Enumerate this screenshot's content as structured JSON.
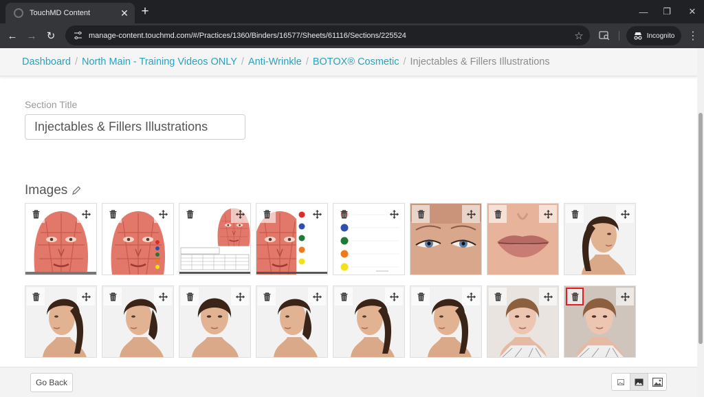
{
  "browser": {
    "tab_title": "TouchMD Content",
    "tab_close": "✕",
    "new_tab": "+",
    "url": "manage-content.touchmd.com/#/Practices/1360/Binders/16577/Sheets/61116/Sections/225524",
    "incognito_label": "Incognito",
    "controls": {
      "minimize": "—",
      "restore": "❐",
      "close": "✕",
      "back": "←",
      "forward": "→",
      "reload": "↻",
      "star": "☆",
      "menu": "⋮"
    }
  },
  "breadcrumb": {
    "items": [
      "Dashboard",
      "North Main - Training Videos ONLY",
      "Anti-Wrinkle",
      "BOTOX® Cosmetic"
    ],
    "current": "Injectables & Fillers Illustrations",
    "separator": "/"
  },
  "section": {
    "label": "Section Title",
    "value": "Injectables & Fillers Illustrations"
  },
  "images": {
    "heading": "Images",
    "tiles": [
      {
        "art": "muscle-face"
      },
      {
        "art": "muscle-face-dots"
      },
      {
        "art": "chart-face"
      },
      {
        "art": "muscle-dots-large"
      },
      {
        "art": "dots-legend"
      },
      {
        "art": "eyes-photo"
      },
      {
        "art": "lips-photo"
      },
      {
        "art": "profile-right-ponytail"
      },
      {
        "art": "profile-left"
      },
      {
        "art": "three-quarter-left"
      },
      {
        "art": "front-face"
      },
      {
        "art": "three-quarter-left-2"
      },
      {
        "art": "profile-left-ponytail"
      },
      {
        "art": "profile-left-ponytail-2"
      },
      {
        "art": "front-photo"
      },
      {
        "art": "front-photo-2"
      }
    ]
  },
  "colors": {
    "link": "#2aa1c0",
    "delete_highlight": "#e51c23",
    "dot_red": "#e02a2a",
    "dot_blue": "#2e4fb0",
    "dot_green": "#1e7a36",
    "dot_orange": "#f07a1a",
    "dot_yellow": "#f2e21a"
  },
  "footer": {
    "go_back": "Go Back",
    "size_buttons": [
      "small-size",
      "medium-size",
      "large-size"
    ],
    "active_size": "medium-size"
  }
}
